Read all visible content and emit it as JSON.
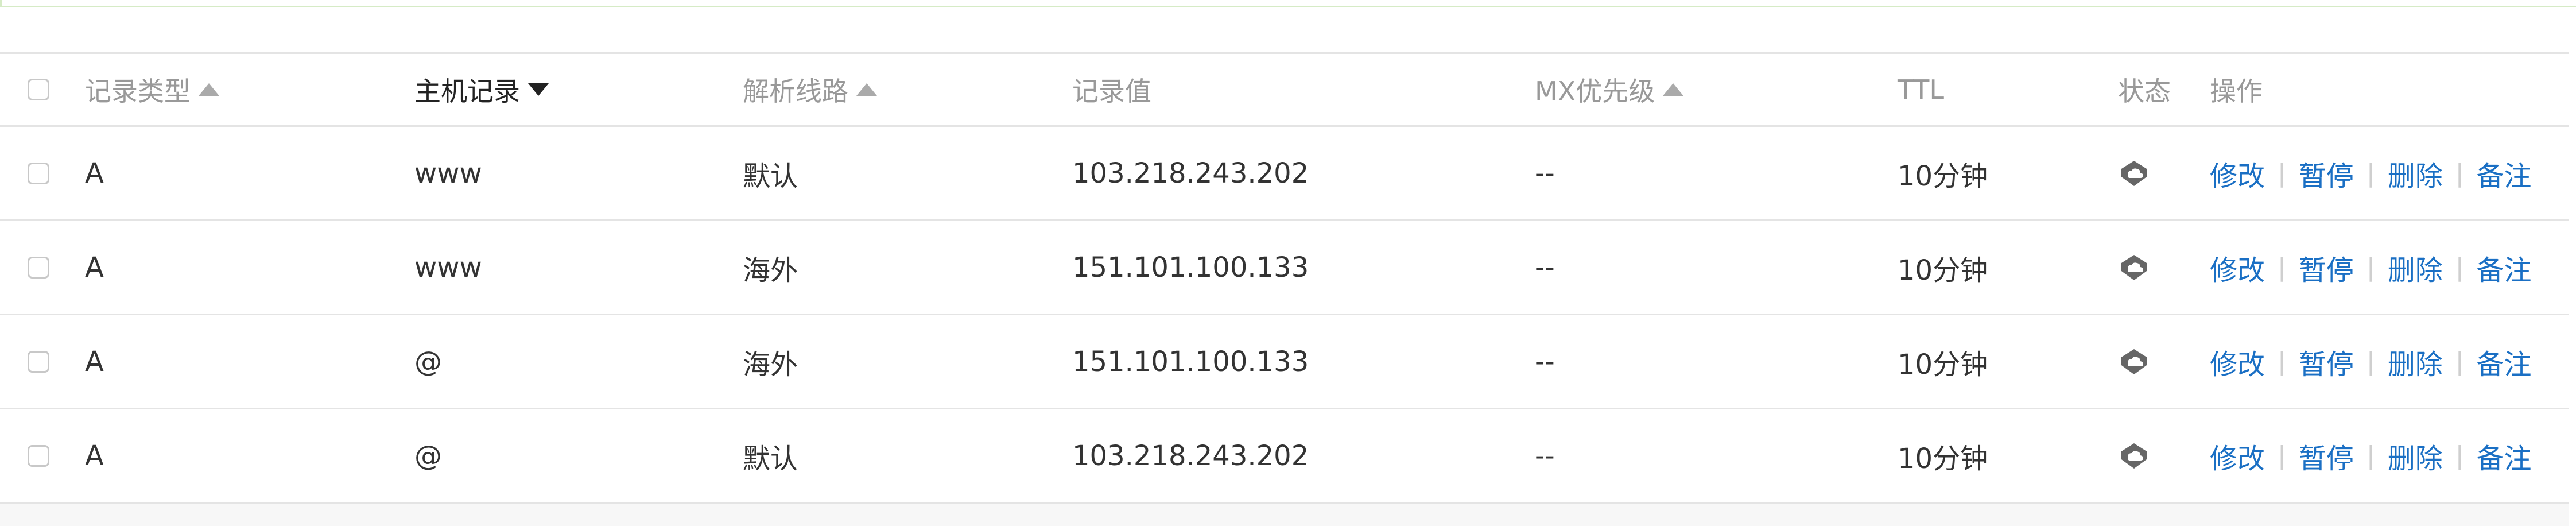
{
  "columns": {
    "type": "记录类型",
    "host": "主机记录",
    "line": "解析线路",
    "value": "记录值",
    "mx": "MX优先级",
    "ttl": "TTL",
    "status": "状态",
    "ops": "操作"
  },
  "sort": {
    "type": "asc",
    "host": "desc",
    "line": "asc",
    "mx": "asc"
  },
  "rows": [
    {
      "type": "A",
      "host": "www",
      "line": "默认",
      "value": "103.218.243.202",
      "mx": "--",
      "ttl": "10分钟",
      "status_icon": "cloud-status-icon"
    },
    {
      "type": "A",
      "host": "www",
      "line": "海外",
      "value": "151.101.100.133",
      "mx": "--",
      "ttl": "10分钟",
      "status_icon": "cloud-status-icon"
    },
    {
      "type": "A",
      "host": "@",
      "line": "海外",
      "value": "151.101.100.133",
      "mx": "--",
      "ttl": "10分钟",
      "status_icon": "cloud-status-icon"
    },
    {
      "type": "A",
      "host": "@",
      "line": "默认",
      "value": "103.218.243.202",
      "mx": "--",
      "ttl": "10分钟",
      "status_icon": "cloud-status-icon"
    }
  ],
  "actions": {
    "edit": "修改",
    "pause": "暂停",
    "delete": "删除",
    "note": "备注",
    "separator": "|"
  },
  "colors": {
    "link": "#1a6fc4",
    "header_text": "#999999",
    "active_header_text": "#222222",
    "border": "#e4e4e4",
    "top_banner_border": "#d6ebc6"
  }
}
